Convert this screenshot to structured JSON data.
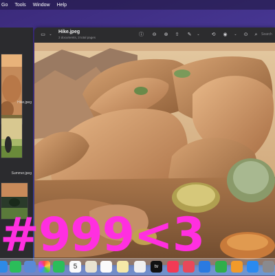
{
  "menubar": {
    "items": [
      "Go",
      "Tools",
      "Window",
      "Help"
    ]
  },
  "sidebar": {
    "thumbnails": [
      {
        "label": "Hike.jpeg"
      },
      {
        "label": "Summer.jpeg"
      },
      {
        "label": ""
      }
    ]
  },
  "preview": {
    "title": "Hike.jpeg",
    "subtitle": "3 documents, 3 total pages",
    "search_placeholder": "Search"
  },
  "overlay_text": "#999<3",
  "dock": {
    "calendar_day": "5",
    "tv_label": "tv"
  }
}
